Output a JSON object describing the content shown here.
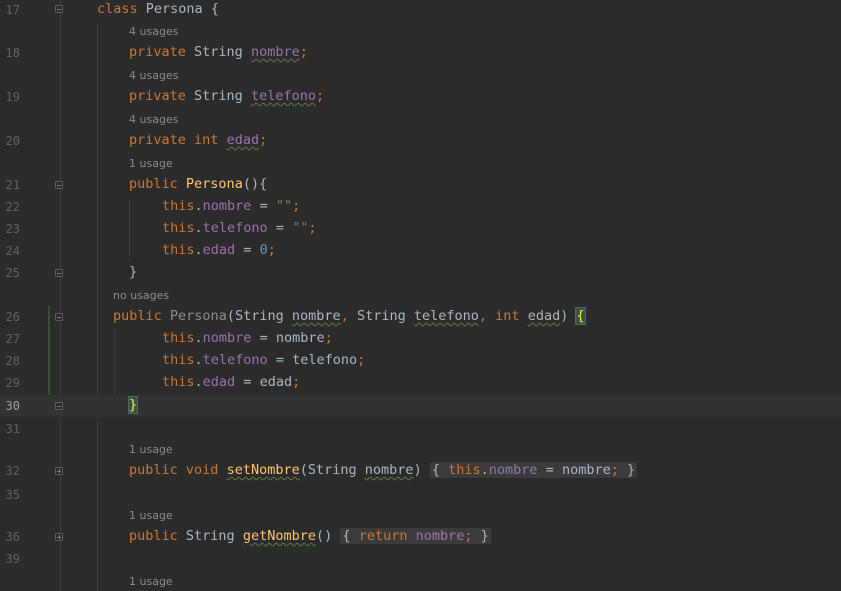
{
  "editor": {
    "language": "java",
    "current_line": 30,
    "lines": [
      {
        "num": "17",
        "hint": null
      },
      {
        "num": "18",
        "hint": "4 usages"
      },
      {
        "num": "19",
        "hint": "4 usages"
      },
      {
        "num": "20",
        "hint": "4 usages"
      },
      {
        "num": "21",
        "hint": "1 usage"
      },
      {
        "num": "22",
        "hint": null
      },
      {
        "num": "23",
        "hint": null
      },
      {
        "num": "24",
        "hint": null
      },
      {
        "num": "25",
        "hint": null
      },
      {
        "num": "26",
        "hint": "no usages"
      },
      {
        "num": "27",
        "hint": null
      },
      {
        "num": "28",
        "hint": null
      },
      {
        "num": "29",
        "hint": null
      },
      {
        "num": "30",
        "hint": null
      },
      {
        "num": "31",
        "hint": null
      },
      {
        "num": "32",
        "hint": "1 usage"
      },
      {
        "num": "35",
        "hint": null
      },
      {
        "num": "36",
        "hint": "1 usage"
      },
      {
        "num": "39",
        "hint": null
      },
      {
        "num": "",
        "hint": "1 usage"
      }
    ],
    "tokens": {
      "class_kw": "class",
      "class_name": "Persona",
      "open_brace": " {",
      "private_kw": "private",
      "public_kw": "public",
      "string_type": "String",
      "int_type": "int",
      "void_kw": "void",
      "this_kw": "this",
      "return_kw": "return",
      "f_nombre": "nombre",
      "f_telefono": "telefono",
      "f_edad": "edad",
      "semicolon": ";",
      "ctor_empty": "Persona",
      "ctor_empty_parens": "(){",
      "dot": ".",
      "assign": " = ",
      "empty_str": "\"\"",
      "zero": "0",
      "close_brace": "}",
      "ctor_args": "Persona",
      "p_open": "(",
      "comma_sp": ", ",
      "p_close": ") ",
      "brace_open": "{",
      "set_nombre": "setNombre",
      "get_nombre": "getNombre",
      "empty_parens": "()",
      "space": " "
    }
  }
}
